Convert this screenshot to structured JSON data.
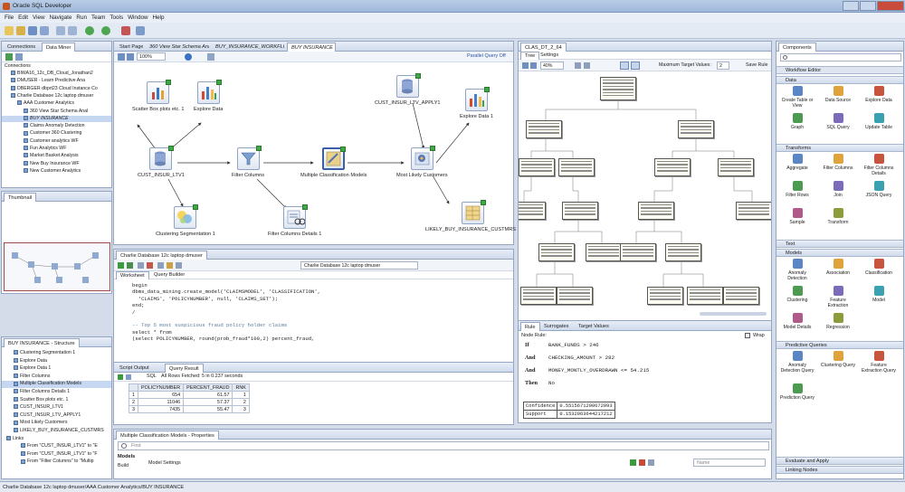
{
  "window": {
    "title": "Oracle SQL Developer"
  },
  "menu": [
    "File",
    "Edit",
    "View",
    "Navigate",
    "Run",
    "Team",
    "Tools",
    "Window",
    "Help"
  ],
  "left": {
    "tabs": [
      "Connections",
      "Data Miner"
    ],
    "tree_header": "Connections",
    "tree": [
      {
        "label": "BIWA16_12c_DB_Cloud_Jonathan2",
        "depth": 1
      },
      {
        "label": "DMUSER - Learn Predictive Ana",
        "depth": 1
      },
      {
        "label": "DBERGER dbprt23 Cloud Instance Co",
        "depth": 1
      },
      {
        "label": "Charlie Database 12c laptop dmuser",
        "depth": 1
      },
      {
        "label": "AAA Customer Analytics",
        "depth": 2
      },
      {
        "label": "360 View Star Schema Anal",
        "depth": 3
      },
      {
        "label": "BUY INSURANCE",
        "depth": 3
      },
      {
        "label": "Claims Anomaly Detection",
        "depth": 3
      },
      {
        "label": "Customer 360 Clustering",
        "depth": 3
      },
      {
        "label": "Customer analytics WF",
        "depth": 3
      },
      {
        "label": "Fun Analytics WF",
        "depth": 3
      },
      {
        "label": "Market Basket Analysis",
        "depth": 3
      },
      {
        "label": "New Buy Insurance WF",
        "depth": 3
      },
      {
        "label": "New Customer Analytics",
        "depth": 3
      }
    ],
    "thumbnail_tab": "Thumbnail",
    "structure_tab": "BUY INSURANCE - Structure",
    "structure": [
      {
        "label": "Clustering Segmentation 1",
        "depth": 1
      },
      {
        "label": "Explore Data",
        "depth": 1
      },
      {
        "label": "Explore Data 1",
        "depth": 1
      },
      {
        "label": "Filter Columns",
        "depth": 1
      },
      {
        "label": "Multiple Classification Models",
        "depth": 1
      },
      {
        "label": "Filter Columns Details 1",
        "depth": 1
      },
      {
        "label": "Scatter Box plots etc. 1",
        "depth": 1
      },
      {
        "label": "CUST_INSUR_LTV1",
        "depth": 1
      },
      {
        "label": "CUST_INSUR_LTV_APPLY1",
        "depth": 1
      },
      {
        "label": "Most Likely Customers",
        "depth": 1
      },
      {
        "label": "LIKELY_BUY_INSURANCE_CUSTMRS",
        "depth": 1
      },
      {
        "label": "Links",
        "depth": 0
      },
      {
        "label": "From \"CUST_INSUR_LTV1\" to \"E",
        "depth": 2
      },
      {
        "label": "From \"CUST_INSUR_LTV1\" to \"F",
        "depth": 2
      },
      {
        "label": "From \"Filter Columns\" to \"Multip",
        "depth": 2
      }
    ]
  },
  "workflow": {
    "tabs": [
      "Start Page",
      "360 View Star Schema Analytics",
      "BUY_INSURANCE_WORKFLOW",
      "BUY INSURANCE"
    ],
    "zoom": "100%",
    "parallel": "Parallel Query Off",
    "nodes": {
      "scatter": "Scatter Box plots etc. 1",
      "explore": "Explore Data",
      "cust": "CUST_INSUR_LTV1",
      "filter": "Filter Columns",
      "mcm": "Multiple Classification Models",
      "apply": "CUST_INSUR_LTV_APPLY1",
      "explore1": "Explore Data 1",
      "likely": "Most Likely Customers",
      "clust": "Clustering Segmentation 1",
      "fcd": "Filter Columns Details 1",
      "buyins": "LIKELY_BUY_INSURANCE_CUSTMRS 1"
    }
  },
  "sql": {
    "tab": "Charlie Database 12c laptop dmuser",
    "connection": "Charlie Database 12c laptop dmuser",
    "subtabs": [
      "Worksheet",
      "Query Builder"
    ],
    "lines": [
      "begin",
      "dbms_data_mining.create_model('CLAIMSMODEL', 'CLASSIFICATION',",
      "  'CLAIMS', 'POLICYNUMBER', null, 'CLAIMS_SET');",
      "end;",
      "/",
      "",
      "-- Top 5 most suspicious fraud policy holder claims",
      "select * from",
      "(select POLICYNUMBER, round(prob_fraud*100,2) percent_fraud,"
    ],
    "output_tabs": [
      "Script Output",
      "Query Result"
    ],
    "sql_label": "SQL",
    "fetch_status": "All Rows Fetched: 5 in 0.237 seconds",
    "result_columns": [
      "",
      "POLICYNUMBER",
      "PERCENT_FRAUD",
      "RNK"
    ],
    "result_rows": [
      [
        "1",
        "654",
        "61.57",
        "1"
      ],
      [
        "2",
        "11046",
        "57.37",
        "2"
      ],
      [
        "3",
        "7435",
        "55.47",
        "3"
      ]
    ]
  },
  "properties": {
    "title": "Multiple Classification Models - Properties",
    "find_placeholder": "Find",
    "models_label": "Models",
    "build_label": "Build",
    "model_settings": "Model Settings",
    "name_placeholder": "Name"
  },
  "tree_viewer": {
    "tab": "CLAS_DT_2_64",
    "subtabs": [
      "Tree",
      "Settings"
    ],
    "zoom": "40%",
    "max_target_label": "Maximum Target Values:",
    "max_target_value": "2",
    "save_rule": "Save Rule",
    "rule_tabs": [
      "Rule",
      "Surrogates",
      "Target Values"
    ],
    "node_rule_label": "Node Rule:",
    "wrap_label": "Wrap",
    "rules": [
      {
        "kw": "If",
        "cond": "BANK_FUNDS > 246"
      },
      {
        "kw": "And",
        "cond": "CHECKING_AMOUNT > 282"
      },
      {
        "kw": "And",
        "cond": "MONEY_MONTLY_OVERDRAWN <= 54.215"
      },
      {
        "kw": "Then",
        "cond": "No"
      }
    ],
    "confidence": [
      [
        "Confidence",
        "0.5515671200672093"
      ],
      [
        "Support",
        "0.1532063644217212"
      ]
    ]
  },
  "components": {
    "tab": "Components",
    "workflow_editor": "Workflow Editor",
    "sections": {
      "data": "Data",
      "transforms": "Transforms",
      "text": "Text",
      "models": "Models",
      "predictive": "Predictive Queries",
      "evaluate": "Evaluate and Apply",
      "linking": "Linking Nodes"
    },
    "data_items": [
      "Create Table or View",
      "Data Source",
      "Explore Data",
      "Graph",
      "SQL Query",
      "Update Table"
    ],
    "transform_items": [
      "Aggregate",
      "Filter Columns",
      "Filter Columns Details",
      "Filter Rows",
      "Join",
      "JSON Query",
      "Sample",
      "Transform"
    ],
    "model_items": [
      "Anomaly Detection",
      "Association",
      "Classification",
      "Clustering",
      "Feature Extraction",
      "Model",
      "Model Details",
      "Regression"
    ],
    "predictive_items": [
      "Anomaly Detection Query",
      "Clustering Query",
      "Feature Extraction Query",
      "Prediction Query"
    ]
  },
  "status": "Charlie Database 12c laptop dmuser/AAA Customer Analytics/BUY INSURANCE"
}
